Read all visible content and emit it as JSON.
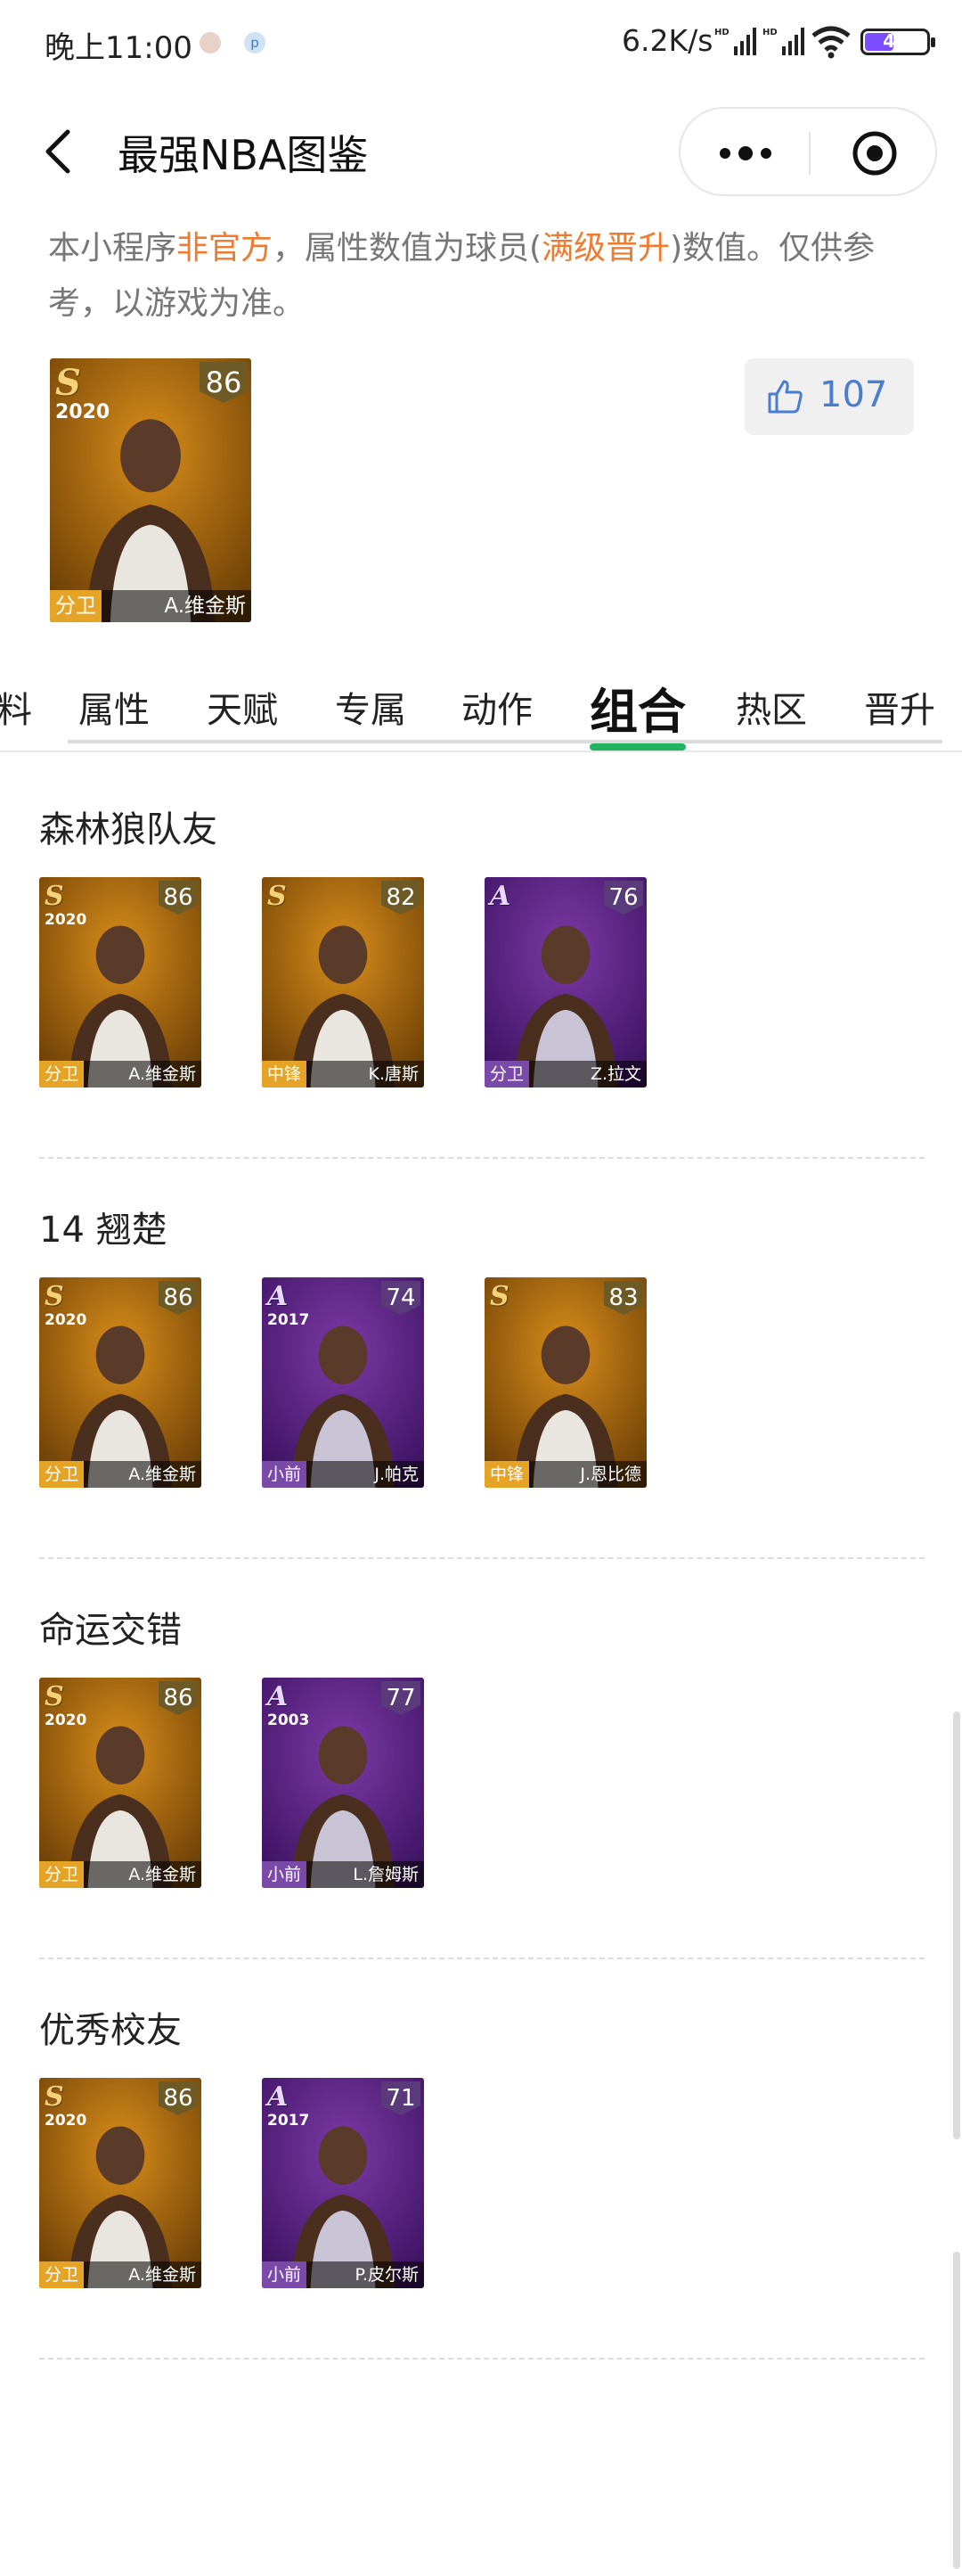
{
  "status_bar": {
    "time": "晚上11:00",
    "speed": "6.2K/s",
    "battery": "47",
    "battery_level": 0.47
  },
  "nav": {
    "title": "最强NBA图鉴",
    "icons": [
      "chevron-left-icon",
      "more-icon",
      "target-icon"
    ]
  },
  "notice": {
    "part1": "本小程序",
    "highlight1": "非官方",
    "part2": "，属性数值为球员(",
    "highlight2": "满级晋升",
    "part3": ")数值。仅供参考，以游戏为准。"
  },
  "hero": {
    "tier": "S",
    "year": "2020",
    "rating": "86",
    "position": "分卫",
    "name": "A.维金斯"
  },
  "like": {
    "count": "107"
  },
  "tabs": [
    "料",
    "属性",
    "天赋",
    "专属",
    "动作",
    "组合",
    "热区",
    "晋升"
  ],
  "active_tab": "组合",
  "colors": {
    "accent_green": "#22b35e",
    "highlight_orange": "#f07a2e",
    "like_blue": "#4a7ccf"
  },
  "groups": [
    {
      "title": "森林狼队友",
      "cards": [
        {
          "tier": "S",
          "year": "2020",
          "rating": "86",
          "position": "分卫",
          "name": "A.维金斯",
          "color": "gold"
        },
        {
          "tier": "S",
          "year": "",
          "rating": "82",
          "position": "中锋",
          "name": "K.唐斯",
          "color": "gold"
        },
        {
          "tier": "A",
          "year": "",
          "rating": "76",
          "position": "分卫",
          "name": "Z.拉文",
          "color": "purple"
        }
      ]
    },
    {
      "title": "14 翘楚",
      "cards": [
        {
          "tier": "S",
          "year": "2020",
          "rating": "86",
          "position": "分卫",
          "name": "A.维金斯",
          "color": "gold"
        },
        {
          "tier": "A",
          "year": "2017",
          "rating": "74",
          "position": "小前",
          "name": "J.帕克",
          "color": "purple"
        },
        {
          "tier": "S",
          "year": "",
          "rating": "83",
          "position": "中锋",
          "name": "J.恩比德",
          "color": "gold"
        }
      ]
    },
    {
      "title": "命运交错",
      "cards": [
        {
          "tier": "S",
          "year": "2020",
          "rating": "86",
          "position": "分卫",
          "name": "A.维金斯",
          "color": "gold"
        },
        {
          "tier": "A",
          "year": "2003",
          "rating": "77",
          "position": "小前",
          "name": "L.詹姆斯",
          "color": "purple"
        }
      ]
    },
    {
      "title": "优秀校友",
      "cards": [
        {
          "tier": "S",
          "year": "2020",
          "rating": "86",
          "position": "分卫",
          "name": "A.维金斯",
          "color": "gold"
        },
        {
          "tier": "A",
          "year": "2017",
          "rating": "71",
          "position": "小前",
          "name": "P.皮尔斯",
          "color": "purple"
        }
      ]
    }
  ]
}
